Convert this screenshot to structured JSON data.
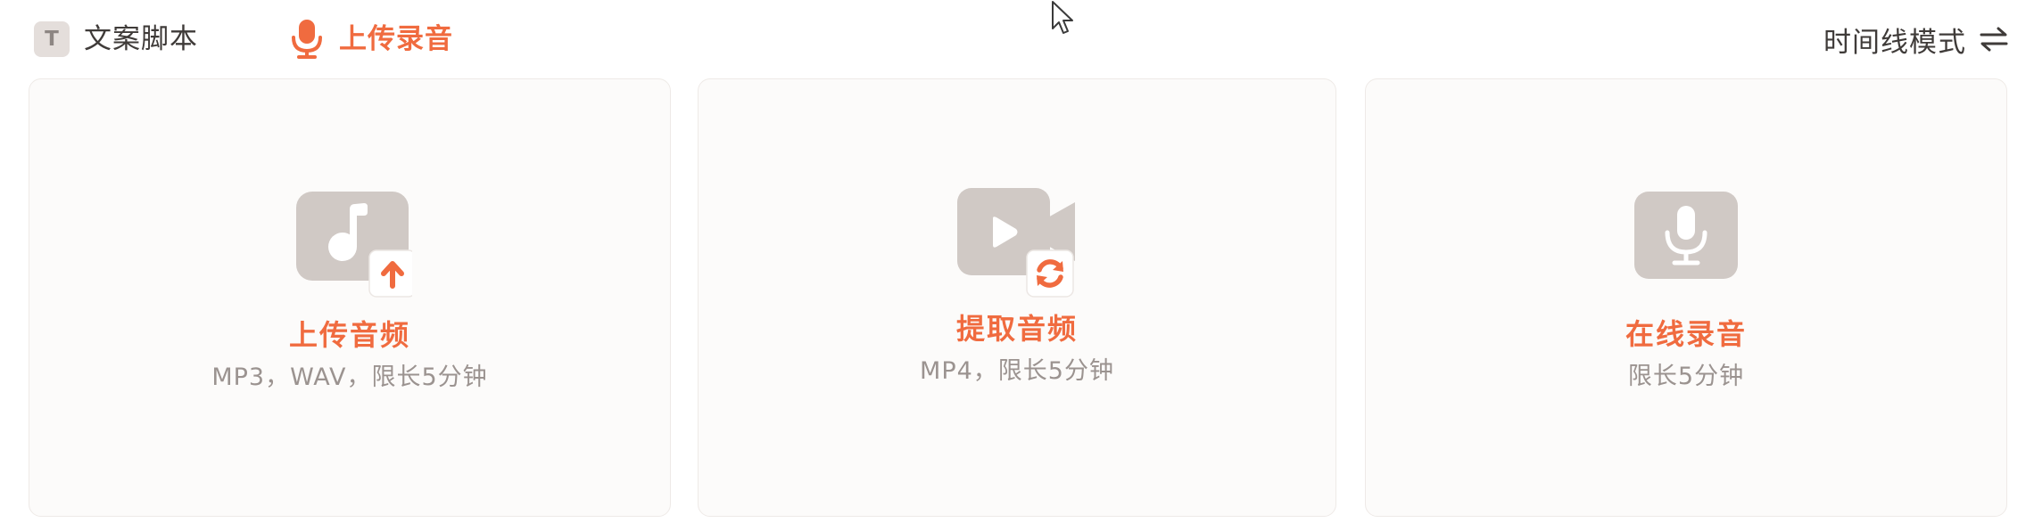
{
  "header": {
    "tabs": [
      {
        "label": "文案脚本",
        "icon": "text-t-icon",
        "icon_glyph": "T",
        "active": false
      },
      {
        "label": "上传录音",
        "icon": "microphone-icon",
        "active": true
      }
    ],
    "mode_toggle": {
      "label": "时间线模式",
      "icon": "swap-arrows-icon"
    }
  },
  "cards": [
    {
      "title": "上传音频",
      "subtitle": "MP3，WAV，限长5分钟",
      "icon": "music-note-icon",
      "badge_icon": "upload-arrow-icon"
    },
    {
      "title": "提取音频",
      "subtitle": "MP4，限长5分钟",
      "icon": "video-camera-icon",
      "badge_icon": "refresh-icon"
    },
    {
      "title": "在线录音",
      "subtitle": "限长5分钟",
      "icon": "microphone-icon"
    }
  ],
  "colors": {
    "accent": "#f06b3f",
    "text": "#3f3b39",
    "muted_text": "#9b9390",
    "icon_fill": "#d0c9c5",
    "card_bg": "#fcfbfa",
    "card_border": "#eeeae7"
  }
}
